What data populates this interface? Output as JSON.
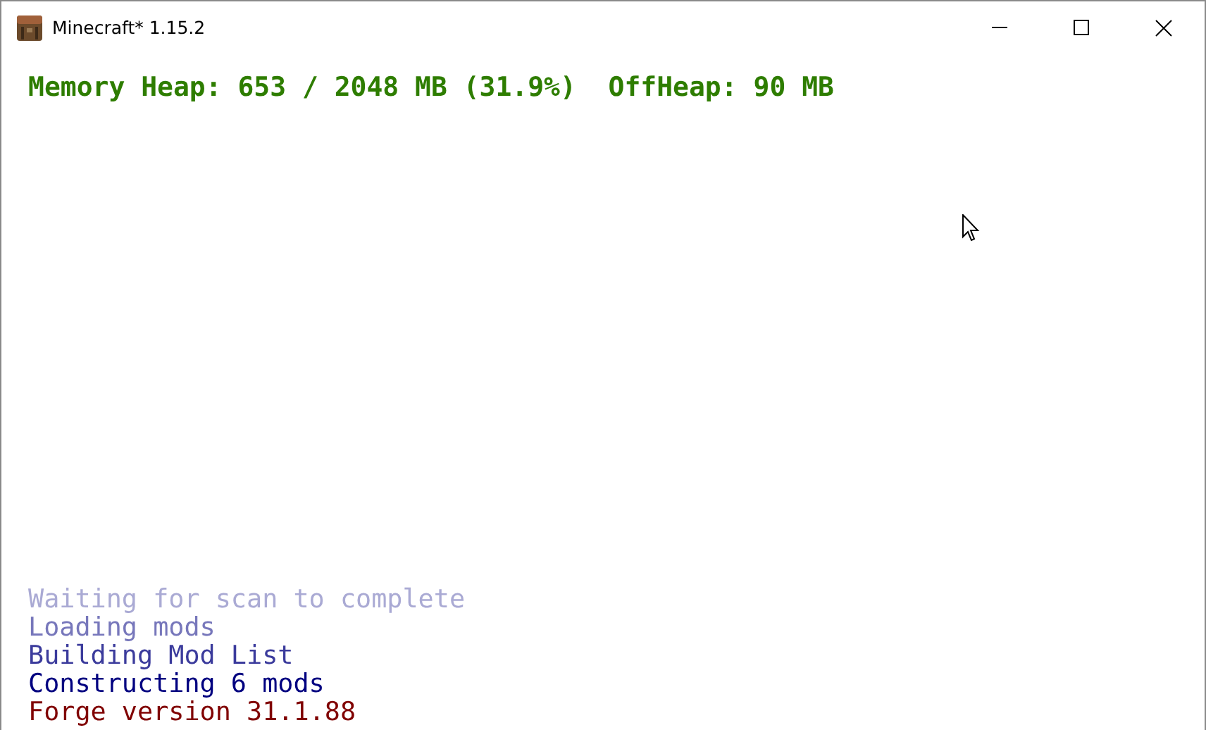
{
  "window": {
    "title": "Minecraft* 1.15.2"
  },
  "memory": "Memory Heap: 653 / 2048 MB (31.9%)  OffHeap: 90 MB",
  "log": [
    {
      "text": "Waiting for scan to complete",
      "color": "#aaaad4"
    },
    {
      "text": "Loading mods",
      "color": "#7777bb"
    },
    {
      "text": "Building Mod List",
      "color": "#3b3b9c"
    },
    {
      "text": "Constructing 6 mods",
      "color": "#000080"
    },
    {
      "text": "Forge version 31.1.88",
      "color": "#800000"
    }
  ]
}
